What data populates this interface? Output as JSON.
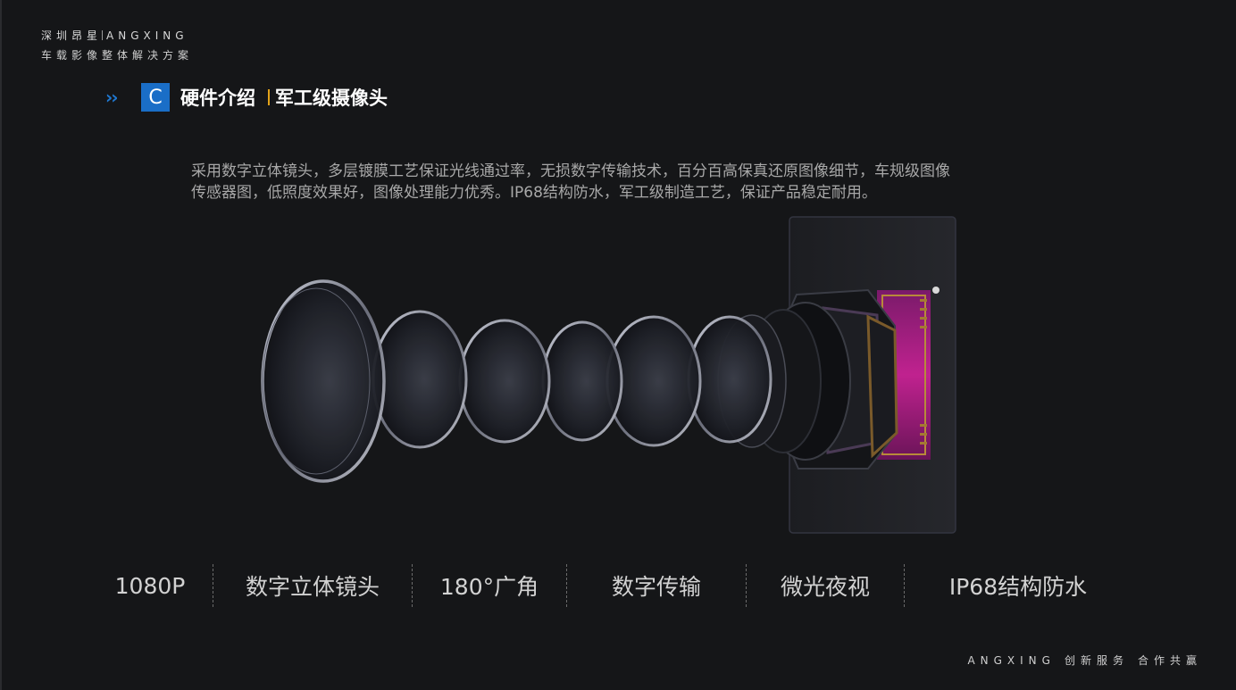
{
  "brand": {
    "company": "深圳昂星",
    "name_en": "ANGXING",
    "tagline": "车载影像整体解决方案"
  },
  "section": {
    "chevrons": "››",
    "letter": "C",
    "title": "硬件介绍",
    "subtitle": "军工级摄像头"
  },
  "description": {
    "line1": "采用数字立体镜头，多层镀膜工艺保证光线通过率，无损数字传输技术，百分百高保真还原图像细节，车规级图像",
    "line2": "传感器图，低照度效果好，图像处理能力优秀。IP68结构防水，军工级制造工艺，保证产品稳定耐用。"
  },
  "features": [
    {
      "label": "1080P"
    },
    {
      "label": "数字立体镜头"
    },
    {
      "label": "180°广角"
    },
    {
      "label": "数字传输"
    },
    {
      "label": "微光夜视"
    },
    {
      "label": "IP68结构防水"
    }
  ],
  "footer": {
    "brand": "ANGXING",
    "slogan1": "创新服务",
    "slogan2": "合作共赢"
  },
  "colors": {
    "background": "#151618",
    "accent_blue": "#1a6ec7",
    "accent_gold": "#e3a31a",
    "sensor_magenta": "#b0208a"
  },
  "icons": {
    "chevrons": "double-chevron-right-icon",
    "illustration": "exploded-camera-lens-illustration"
  }
}
